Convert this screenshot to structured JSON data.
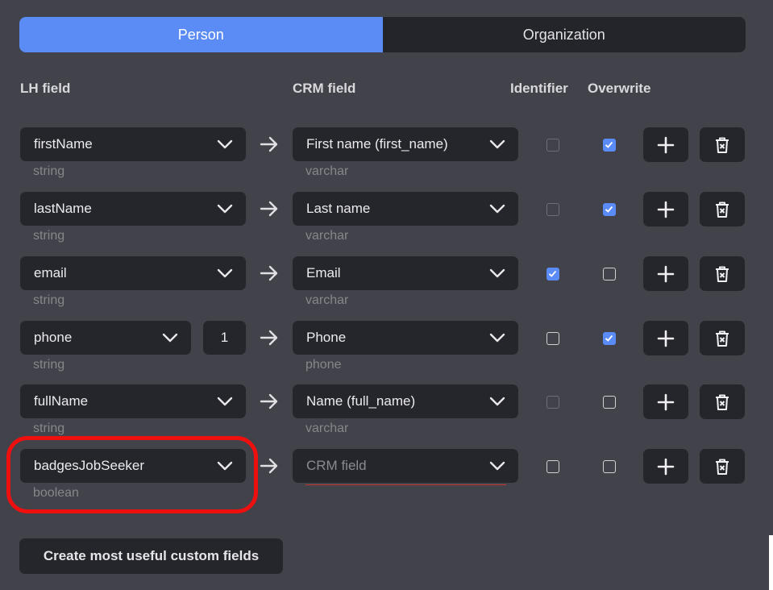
{
  "tabs": [
    {
      "label": "Person",
      "active": true
    },
    {
      "label": "Organization",
      "active": false
    }
  ],
  "headers": {
    "lh_field": "LH field",
    "crm_field": "CRM field",
    "identifier": "Identifier",
    "overwrite": "Overwrite"
  },
  "rows": [
    {
      "lh": "firstName",
      "lh_type": "string",
      "crm": "First name (first_name)",
      "crm_type": "varchar",
      "identifier": false,
      "identifier_disabled": true,
      "overwrite": true
    },
    {
      "lh": "lastName",
      "lh_type": "string",
      "crm": "Last name",
      "crm_type": "varchar",
      "identifier": false,
      "identifier_disabled": true,
      "overwrite": true
    },
    {
      "lh": "email",
      "lh_type": "string",
      "crm": "Email",
      "crm_type": "varchar",
      "identifier": true,
      "identifier_disabled": false,
      "overwrite": false
    },
    {
      "lh": "phone",
      "lh_type": "string",
      "index": "1",
      "crm": "Phone",
      "crm_type": "phone",
      "identifier": false,
      "identifier_disabled": false,
      "overwrite": true
    },
    {
      "lh": "fullName",
      "lh_type": "string",
      "crm": "Name (full_name)",
      "crm_type": "varchar",
      "identifier": false,
      "identifier_disabled": true,
      "overwrite": false
    },
    {
      "lh": "badgesJobSeeker",
      "lh_type": "boolean",
      "crm_placeholder": "CRM field",
      "identifier": false,
      "identifier_disabled": false,
      "overwrite": false
    }
  ],
  "create_button": "Create most useful custom fields",
  "colors": {
    "accent": "#5b8cf5",
    "highlight": "#ee0f0f",
    "error_underline": "#c4362f"
  },
  "icons": {
    "dropdown": "chevron-down-icon",
    "arrow": "arrow-right-icon",
    "add": "plus-icon",
    "delete": "trash-icon"
  }
}
